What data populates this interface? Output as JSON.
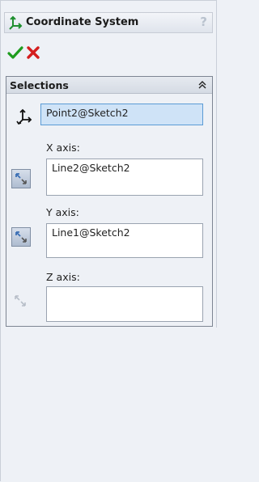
{
  "panel": {
    "title": "Coordinate System",
    "help_glyph": "?"
  },
  "selections": {
    "title": "Selections",
    "origin_value": "Point2@Sketch2",
    "x_axis_label": "X axis:",
    "x_axis_value": "Line2@Sketch2",
    "y_axis_label": "Y axis:",
    "y_axis_value": "Line1@Sketch2",
    "z_axis_label": "Z axis:",
    "z_axis_value": ""
  },
  "colors": {
    "ok_green": "#1e9c1e",
    "cancel_red": "#d41e1e",
    "accent_blue": "#5b9bd5"
  }
}
